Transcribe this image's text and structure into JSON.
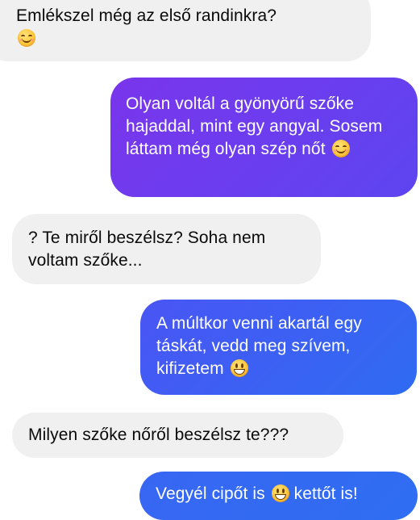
{
  "messages": [
    {
      "side": "incoming",
      "text": "Emlékszel még az első randinkra?",
      "emoji": "smiling-face-icon"
    },
    {
      "side": "outgoing",
      "text": "Olyan voltál a gyönyörű szőke hajaddal, mint egy angyal. Sosem láttam még olyan szép nőt",
      "emoji": "smiling-face-icon"
    },
    {
      "side": "incoming",
      "text": "? Te miről beszélsz? Soha nem voltam szőke..."
    },
    {
      "side": "outgoing",
      "text": "A múltkor venni akartál egy táskát, vedd meg szívem, kifizetem",
      "emoji": "grinning-face-icon"
    },
    {
      "side": "incoming",
      "text": "Milyen szőke nőről beszélsz te???"
    },
    {
      "side": "outgoing",
      "text_before": "Vegyél cipőt is",
      "emoji": "grinning-face-icon",
      "text_after": "kettőt is!"
    }
  ],
  "colors": {
    "incoming_bubble": "#f0f0f0",
    "outgoing_purple": "#6a3cf0",
    "outgoing_blue": "#2f6bf2",
    "background": "#ffffff"
  }
}
